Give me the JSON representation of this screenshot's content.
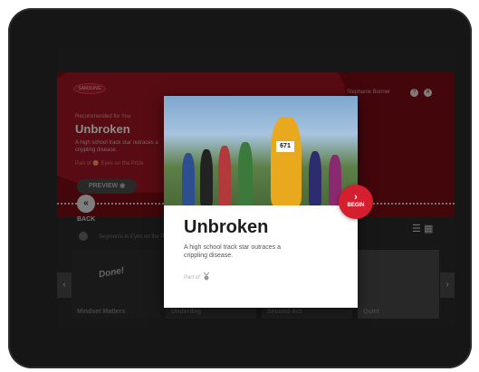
{
  "app": {
    "brand_logo_text": "SAMSUNG",
    "user_name": "Stephanie Bonner",
    "help_icon": "question-circle-icon",
    "close_icon": "close-circle-icon"
  },
  "hero": {
    "eyebrow": "Recommended for You",
    "title": "Unbroken",
    "description": "A high school track star outraces a crippling disease.",
    "part_of_prefix": "Part of",
    "part_of_series": "Eyes on the Prize",
    "preview_label": "PREVIEW"
  },
  "back": {
    "label": "BACK",
    "icon": "double-chevron-left-icon"
  },
  "segments": {
    "prefix": "Segments in",
    "series": "Eyes on the Prize"
  },
  "tiles": [
    {
      "label": "Mindset Matters",
      "overlay_text": "Done!"
    },
    {
      "label": "Underdog"
    },
    {
      "label": "Second Act"
    },
    {
      "label": "Quiet"
    }
  ],
  "modal": {
    "title": "Unbroken",
    "description": "A high school track star outraces a crippling disease.",
    "part_of_label": "Part of",
    "begin_label": "BEGIN",
    "begin_icon": "chevron-right-icon",
    "photo_bib": "671"
  },
  "colors": {
    "brand_red": "#d51f2f",
    "hero_dark_red": "#7a0c15"
  }
}
